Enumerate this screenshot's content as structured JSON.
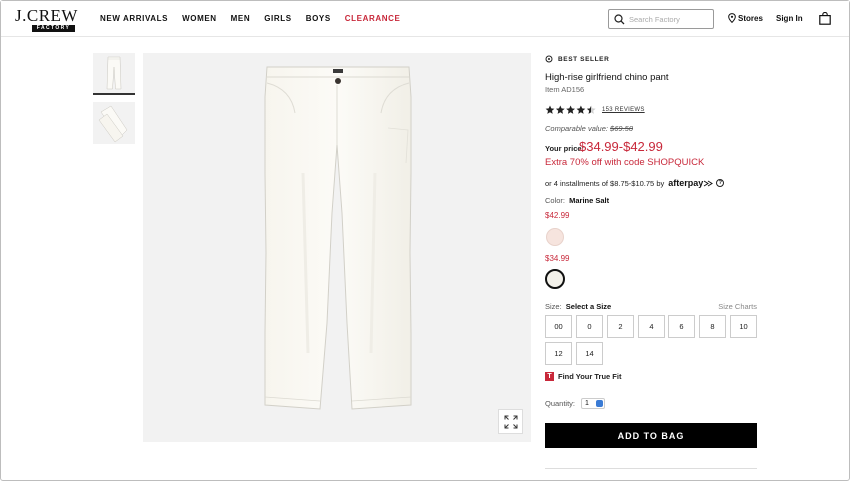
{
  "header": {
    "logo_main": "J.CREW",
    "logo_sub": "FACTORY",
    "nav": [
      "NEW ARRIVALS",
      "WOMEN",
      "MEN",
      "GIRLS",
      "BOYS",
      "CLEARANCE"
    ],
    "search_placeholder": "Search Factory",
    "stores": "Stores",
    "sign_in": "Sign In"
  },
  "product": {
    "badge": "BEST SELLER",
    "title": "High-rise girlfriend chino pant",
    "item_number": "Item AD156",
    "rating": 4.5,
    "reviews": "153 REVIEWS",
    "comparable_label": "Comparable value:",
    "comparable_value": "$69.50",
    "price_label": "Your price:",
    "price": "$34.99-$42.99",
    "promo": "Extra 70% off with code SHOPQUICK",
    "installments": "or 4 installments of $8.75-$10.75 by",
    "afterpay_brand": "afterpay",
    "color_label": "Color:",
    "color_value": "Marine Salt",
    "color_groups": [
      {
        "price": "$42.99",
        "swatch": "#f6e4de"
      },
      {
        "price": "$34.99",
        "swatch": "#f3f1ea"
      }
    ],
    "size_label": "Size:",
    "size_value": "Select a Size",
    "size_charts": "Size Charts",
    "sizes": [
      "00",
      "0",
      "2",
      "4",
      "6",
      "8",
      "10",
      "12",
      "14"
    ],
    "fit_icon": "T",
    "fit_label": "Find Your True Fit",
    "quantity_label": "Quantity:",
    "quantity_value": "1",
    "add_to_bag": "ADD TO BAG"
  },
  "colors": {
    "accent_red": "#c8283a",
    "button_black": "#000000",
    "image_bg": "#f2f2f2"
  }
}
